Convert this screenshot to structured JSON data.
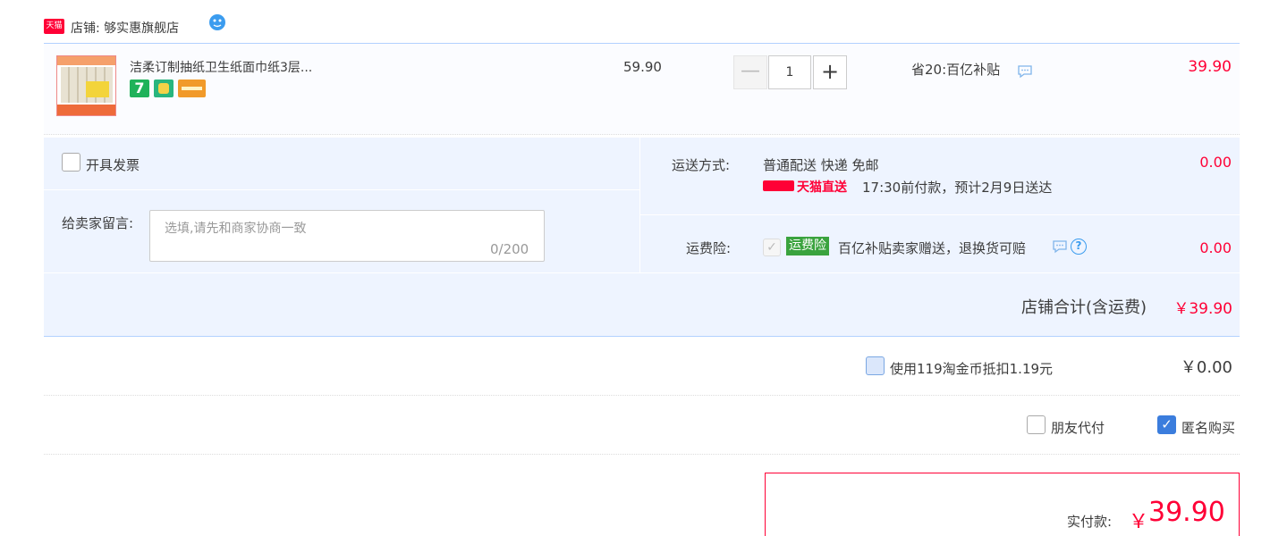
{
  "shop": {
    "logo_text": "天猫",
    "label": "店铺: 够实惠旗舰店",
    "chat_icon": "wangwang-chat-icon"
  },
  "product": {
    "title": "洁柔订制抽纸卫生纸面巾纸3层...",
    "tags": [
      "7",
      "robot-service-icon",
      "card-icon"
    ],
    "unit_price": "59.90",
    "quantity": "1",
    "qty_minus": "—",
    "qty_plus": "+",
    "discount": "省20:百亿补贴",
    "price": "39.90"
  },
  "options": {
    "invoice_label": "开具发票",
    "invoice_checked": false,
    "message_label": "给卖家留言:",
    "message_placeholder": "选填,请先和商家协商一致",
    "message_count": "0/200"
  },
  "shipping": {
    "label": "运送方式:",
    "method": "普通配送 快递 免邮",
    "fee": "0.00",
    "tmall_direct": "天猫直送",
    "delivery_note": "17:30前付款，预计2月9日送达"
  },
  "insurance": {
    "label": "运费险:",
    "checked": true,
    "badge": "运费险",
    "desc": "百亿补贴卖家赠送，退换货可赔",
    "help": "?",
    "fee": "0.00"
  },
  "store_total": {
    "label": "店铺合计(含运费)",
    "value": "￥39.90"
  },
  "coins": {
    "label": "使用119淘金币抵扣1.19元",
    "checked": false,
    "amount": "￥0.00"
  },
  "pay_options": {
    "friend_label": "朋友代付",
    "friend_checked": false,
    "anon_label": "匿名购买",
    "anon_checked": true
  },
  "payment": {
    "label": "实付款:",
    "currency": "￥",
    "amount": "39.90"
  },
  "colors": {
    "accent_red": "#ff0036",
    "panel_blue": "#eef4ff",
    "border_blue": "#b2d1ff",
    "check_blue": "#3b7ddd"
  }
}
